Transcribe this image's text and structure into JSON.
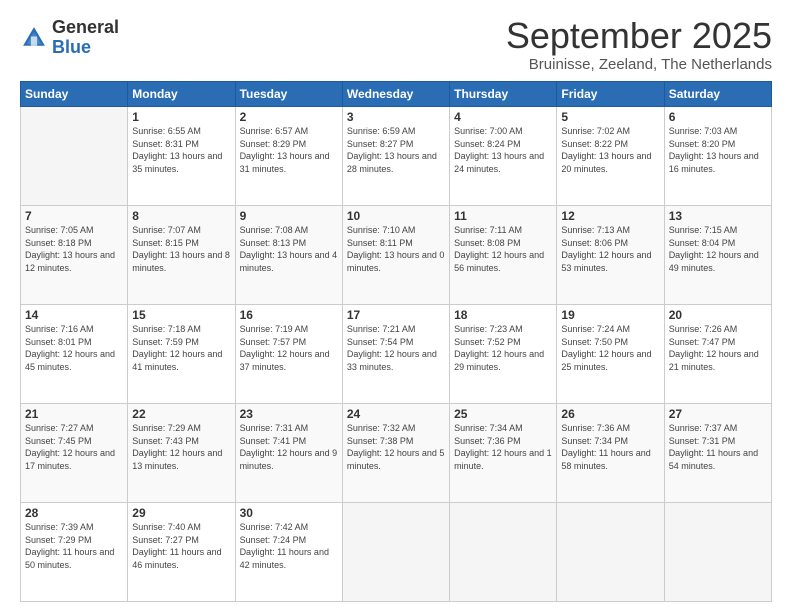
{
  "logo": {
    "general": "General",
    "blue": "Blue"
  },
  "header": {
    "title": "September 2025",
    "subtitle": "Bruinisse, Zeeland, The Netherlands"
  },
  "days_of_week": [
    "Sunday",
    "Monday",
    "Tuesday",
    "Wednesday",
    "Thursday",
    "Friday",
    "Saturday"
  ],
  "weeks": [
    [
      {
        "num": "",
        "empty": true
      },
      {
        "num": "1",
        "sunrise": "6:55 AM",
        "sunset": "8:31 PM",
        "daylight": "13 hours and 35 minutes."
      },
      {
        "num": "2",
        "sunrise": "6:57 AM",
        "sunset": "8:29 PM",
        "daylight": "13 hours and 31 minutes."
      },
      {
        "num": "3",
        "sunrise": "6:59 AM",
        "sunset": "8:27 PM",
        "daylight": "13 hours and 28 minutes."
      },
      {
        "num": "4",
        "sunrise": "7:00 AM",
        "sunset": "8:24 PM",
        "daylight": "13 hours and 24 minutes."
      },
      {
        "num": "5",
        "sunrise": "7:02 AM",
        "sunset": "8:22 PM",
        "daylight": "13 hours and 20 minutes."
      },
      {
        "num": "6",
        "sunrise": "7:03 AM",
        "sunset": "8:20 PM",
        "daylight": "13 hours and 16 minutes."
      }
    ],
    [
      {
        "num": "7",
        "sunrise": "7:05 AM",
        "sunset": "8:18 PM",
        "daylight": "13 hours and 12 minutes."
      },
      {
        "num": "8",
        "sunrise": "7:07 AM",
        "sunset": "8:15 PM",
        "daylight": "13 hours and 8 minutes."
      },
      {
        "num": "9",
        "sunrise": "7:08 AM",
        "sunset": "8:13 PM",
        "daylight": "13 hours and 4 minutes."
      },
      {
        "num": "10",
        "sunrise": "7:10 AM",
        "sunset": "8:11 PM",
        "daylight": "13 hours and 0 minutes."
      },
      {
        "num": "11",
        "sunrise": "7:11 AM",
        "sunset": "8:08 PM",
        "daylight": "12 hours and 56 minutes."
      },
      {
        "num": "12",
        "sunrise": "7:13 AM",
        "sunset": "8:06 PM",
        "daylight": "12 hours and 53 minutes."
      },
      {
        "num": "13",
        "sunrise": "7:15 AM",
        "sunset": "8:04 PM",
        "daylight": "12 hours and 49 minutes."
      }
    ],
    [
      {
        "num": "14",
        "sunrise": "7:16 AM",
        "sunset": "8:01 PM",
        "daylight": "12 hours and 45 minutes."
      },
      {
        "num": "15",
        "sunrise": "7:18 AM",
        "sunset": "7:59 PM",
        "daylight": "12 hours and 41 minutes."
      },
      {
        "num": "16",
        "sunrise": "7:19 AM",
        "sunset": "7:57 PM",
        "daylight": "12 hours and 37 minutes."
      },
      {
        "num": "17",
        "sunrise": "7:21 AM",
        "sunset": "7:54 PM",
        "daylight": "12 hours and 33 minutes."
      },
      {
        "num": "18",
        "sunrise": "7:23 AM",
        "sunset": "7:52 PM",
        "daylight": "12 hours and 29 minutes."
      },
      {
        "num": "19",
        "sunrise": "7:24 AM",
        "sunset": "7:50 PM",
        "daylight": "12 hours and 25 minutes."
      },
      {
        "num": "20",
        "sunrise": "7:26 AM",
        "sunset": "7:47 PM",
        "daylight": "12 hours and 21 minutes."
      }
    ],
    [
      {
        "num": "21",
        "sunrise": "7:27 AM",
        "sunset": "7:45 PM",
        "daylight": "12 hours and 17 minutes."
      },
      {
        "num": "22",
        "sunrise": "7:29 AM",
        "sunset": "7:43 PM",
        "daylight": "12 hours and 13 minutes."
      },
      {
        "num": "23",
        "sunrise": "7:31 AM",
        "sunset": "7:41 PM",
        "daylight": "12 hours and 9 minutes."
      },
      {
        "num": "24",
        "sunrise": "7:32 AM",
        "sunset": "7:38 PM",
        "daylight": "12 hours and 5 minutes."
      },
      {
        "num": "25",
        "sunrise": "7:34 AM",
        "sunset": "7:36 PM",
        "daylight": "12 hours and 1 minute."
      },
      {
        "num": "26",
        "sunrise": "7:36 AM",
        "sunset": "7:34 PM",
        "daylight": "11 hours and 58 minutes."
      },
      {
        "num": "27",
        "sunrise": "7:37 AM",
        "sunset": "7:31 PM",
        "daylight": "11 hours and 54 minutes."
      }
    ],
    [
      {
        "num": "28",
        "sunrise": "7:39 AM",
        "sunset": "7:29 PM",
        "daylight": "11 hours and 50 minutes."
      },
      {
        "num": "29",
        "sunrise": "7:40 AM",
        "sunset": "7:27 PM",
        "daylight": "11 hours and 46 minutes."
      },
      {
        "num": "30",
        "sunrise": "7:42 AM",
        "sunset": "7:24 PM",
        "daylight": "11 hours and 42 minutes."
      },
      {
        "num": "",
        "empty": true
      },
      {
        "num": "",
        "empty": true
      },
      {
        "num": "",
        "empty": true
      },
      {
        "num": "",
        "empty": true
      }
    ]
  ]
}
